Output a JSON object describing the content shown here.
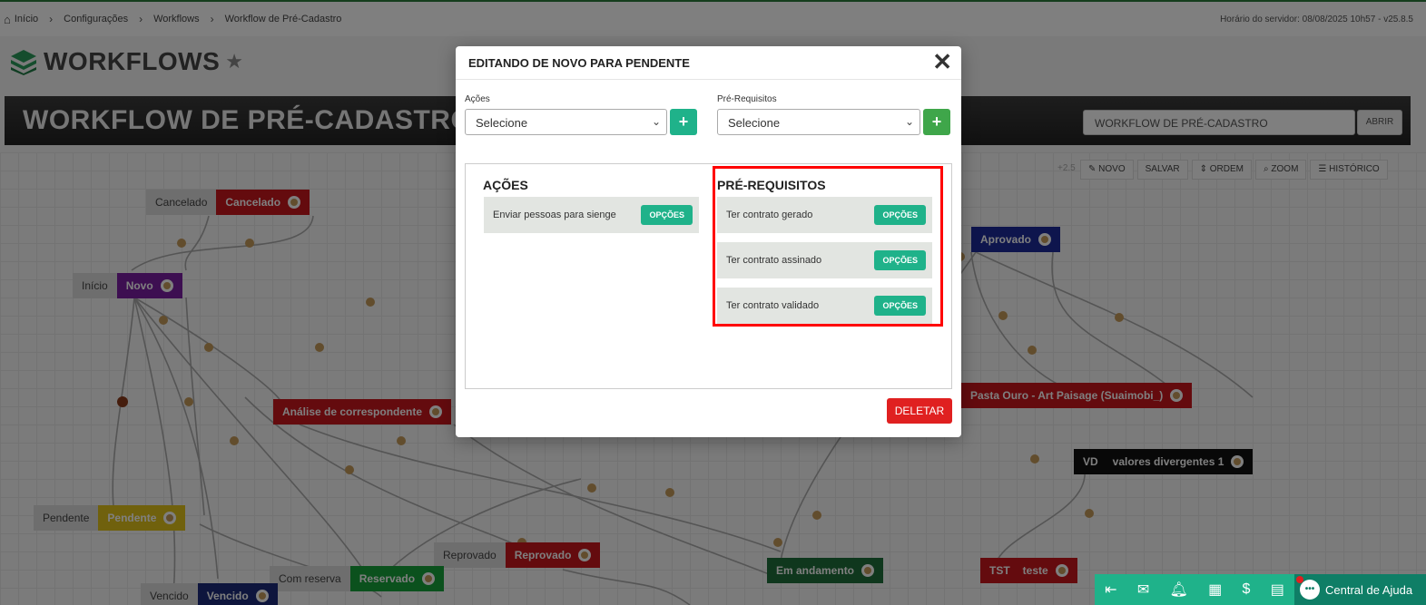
{
  "breadcrumb": [
    "Início",
    "Configurações",
    "Workflows",
    "Workflow de Pré-Cadastro"
  ],
  "server_time": "Horário do servidor: 08/08/2025 10h57 - v25.8.5",
  "page_title": "WORKFLOWS",
  "workflow_title": "WORKFLOW DE PRÉ-CADASTRO",
  "workflow_select": "WORKFLOW DE PRÉ-CADASTRO",
  "open_label": "ABRIR",
  "zoom_hint": "+2.5",
  "toolbar": [
    "NOVO",
    "SALVAR",
    "ORDEM",
    "ZOOM",
    "HISTÓRICO"
  ],
  "nodes": [
    {
      "label": "Cancelado",
      "name": "Cancelado",
      "color": "#c8161d"
    },
    {
      "label": "Início",
      "name": "Novo",
      "color": "#7a1fa2"
    },
    {
      "label": "",
      "name": "Análise de correspondente",
      "color": "#c8161d"
    },
    {
      "label": "Pendente",
      "name": "Pendente",
      "color": "#e0c21a"
    },
    {
      "label": "Reprovado",
      "name": "Reprovado",
      "color": "#c8161d"
    },
    {
      "label": "Com reserva",
      "name": "Reservado",
      "color": "#17a23a"
    },
    {
      "label": "Vencido",
      "name": "Vencido",
      "color": "#1c2a7a"
    },
    {
      "label": "",
      "name": "Aprovado",
      "color": "#1c2a9a"
    },
    {
      "label": "",
      "name": "Pasta Ouro - Art Paisage (Suaimobi_)",
      "color": "#c8161d"
    },
    {
      "label": "VD",
      "name": "valores divergentes 1",
      "color": "#111111"
    },
    {
      "label": "",
      "name": "Em andamento",
      "color": "#1f6e3a"
    },
    {
      "label": "TST",
      "name": "teste",
      "color": "#c8161d"
    }
  ],
  "modal": {
    "title": "EDITANDO DE NOVO PARA PENDENTE",
    "actions_label": "Ações",
    "actions_select": "Selecione",
    "prereq_label": "Pré-Requisitos",
    "prereq_select": "Selecione",
    "add": "+",
    "actions_title": "AÇÕES",
    "prereq_title": "PRÉ-REQUISITOS",
    "options_label": "OPÇÕES",
    "actions": [
      "Enviar pessoas para sienge"
    ],
    "prereqs": [
      "Ter contrato gerado",
      "Ter contrato assinado",
      "Ter contrato validado"
    ],
    "delete_label": "DELETAR",
    "close": "✕"
  },
  "help_label": "Central de Ajuda"
}
